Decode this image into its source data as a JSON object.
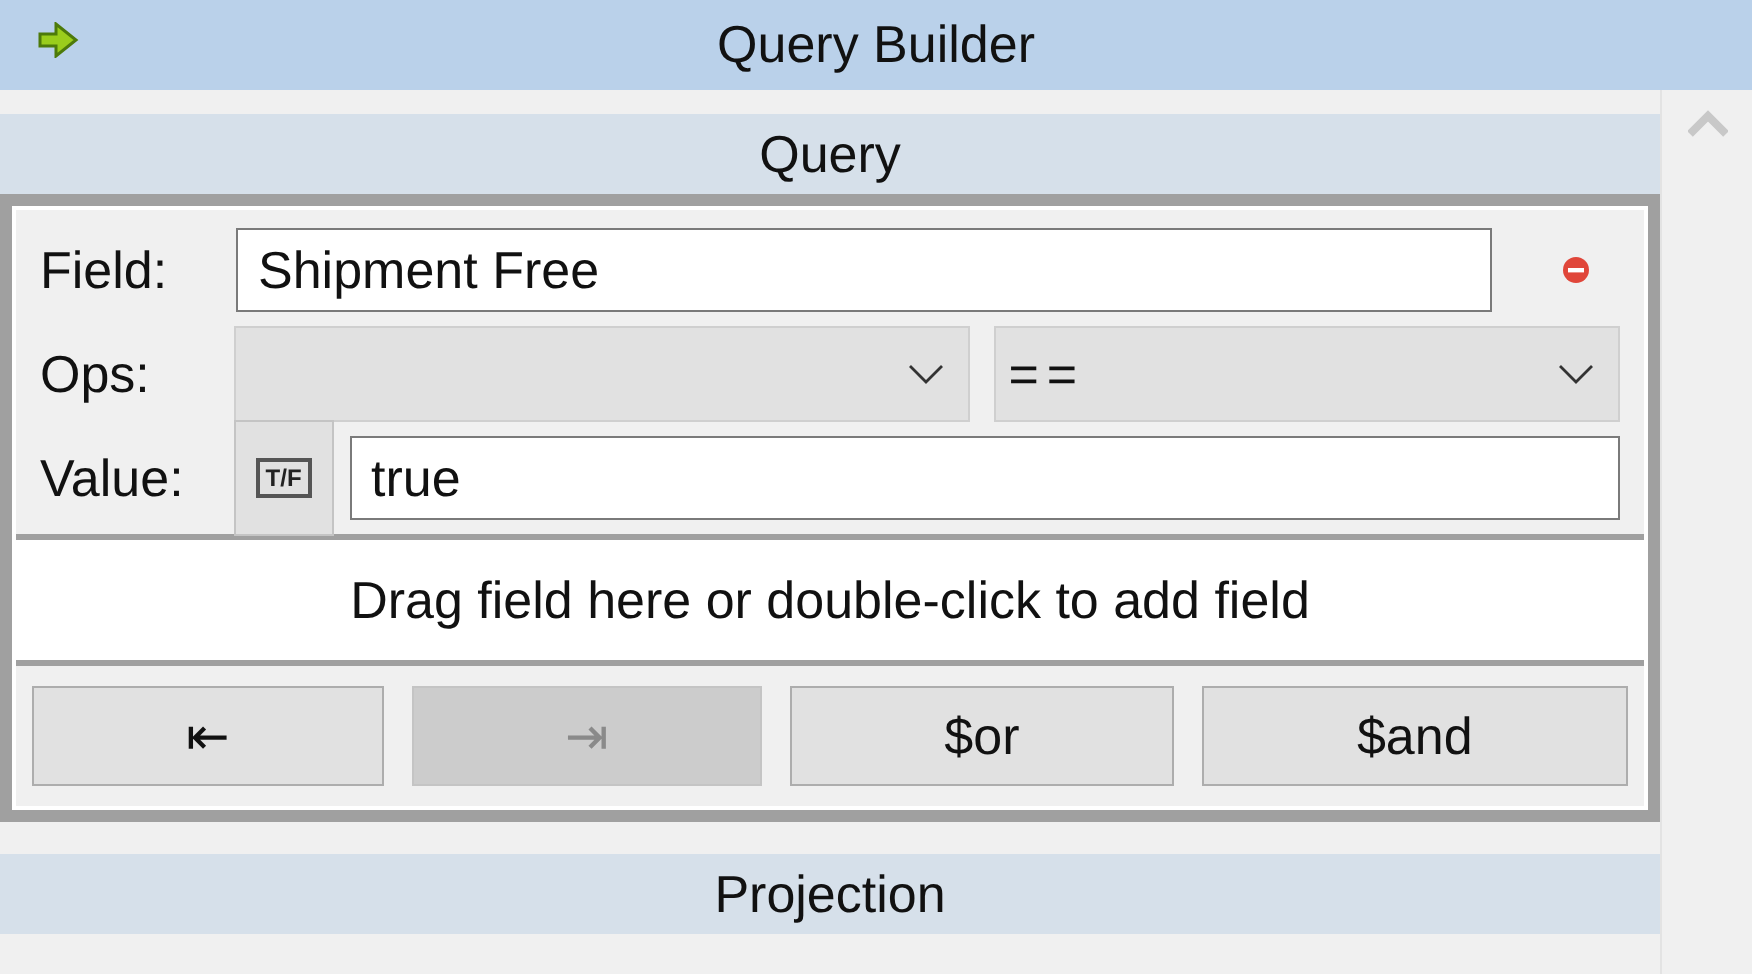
{
  "title_bar": {
    "title": "Query Builder"
  },
  "query": {
    "header": "Query",
    "field": {
      "label": "Field:",
      "value": "Shipment Free"
    },
    "ops": {
      "label": "Ops:",
      "operator": "=="
    },
    "value": {
      "label": "Value:",
      "type_button": "T/F",
      "value": "true"
    },
    "drop_zone": "Drag field here or double-click to add field",
    "buttons": [
      {
        "label": "⇤",
        "disabled": false
      },
      {
        "label": "⇥",
        "disabled": true
      },
      {
        "label": "$or",
        "disabled": false
      },
      {
        "label": "$and",
        "disabled": false
      }
    ]
  },
  "projection": {
    "header": "Projection"
  }
}
